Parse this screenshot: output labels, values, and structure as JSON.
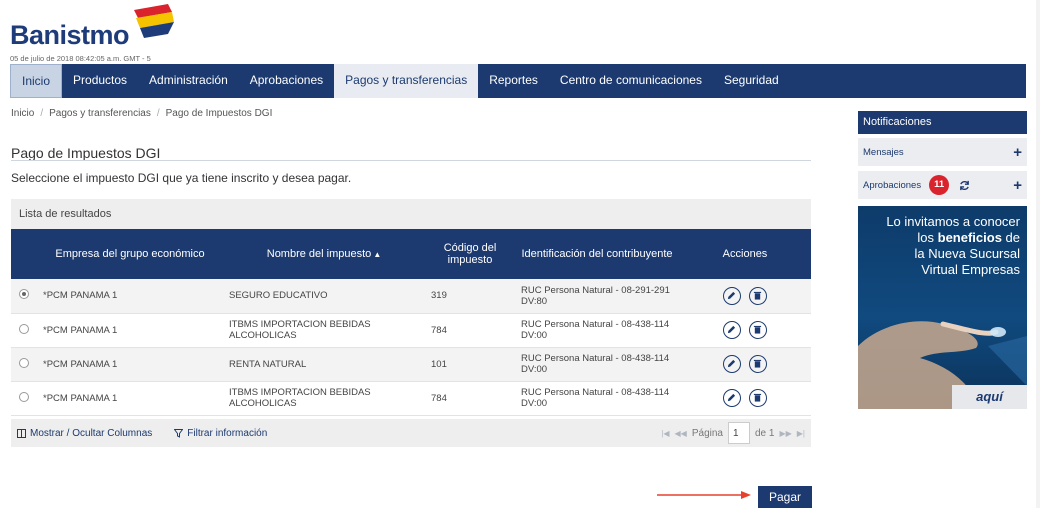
{
  "brand": {
    "name": "Banistmo"
  },
  "header": {
    "date": "05 de julio de 2018 08:42:05 a.m. GMT - 5"
  },
  "nav": {
    "items": [
      "Inicio",
      "Productos",
      "Administración",
      "Aprobaciones",
      "Pagos y transferencias",
      "Reportes",
      "Centro de comunicaciones",
      "Seguridad"
    ],
    "active": "Pagos y transferencias"
  },
  "breadcrumb": [
    "Inicio",
    "Pagos y transferencias",
    "Pago de Impuestos DGI"
  ],
  "page": {
    "title": "Pago de Impuestos DGI",
    "subtitle": "Seleccione el impuesto DGI que ya tiene inscrito y desea pagar."
  },
  "results": {
    "heading": "Lista de resultados",
    "columns": [
      "Empresa del grupo económico",
      "Nombre del impuesto",
      "Código del impuesto",
      "Identificación del contribuyente",
      "Acciones"
    ],
    "rows": [
      {
        "selected": true,
        "empresa": "*PCM PANAMA 1",
        "impuesto": "SEGURO EDUCATIVO",
        "codigo": "319",
        "identificacion": "RUC Persona Natural - 08-291-291 DV:80"
      },
      {
        "selected": false,
        "empresa": "*PCM PANAMA 1",
        "impuesto": "ITBMS IMPORTACION BEBIDAS ALCOHOLICAS",
        "codigo": "784",
        "identificacion": "RUC Persona Natural - 08-438-114 DV:00"
      },
      {
        "selected": false,
        "empresa": "*PCM PANAMA 1",
        "impuesto": "RENTA NATURAL",
        "codigo": "101",
        "identificacion": "RUC Persona Natural - 08-438-114 DV:00"
      },
      {
        "selected": false,
        "empresa": "*PCM PANAMA 1",
        "impuesto": "ITBMS IMPORTACION BEBIDAS ALCOHOLICAS",
        "codigo": "784",
        "identificacion": "RUC Persona Natural - 08-438-114 DV:00"
      }
    ],
    "footer": {
      "toggle_columns": "Mostrar / Ocultar Columnas",
      "filter": "Filtrar información",
      "page_label": "Página",
      "page_value": "1",
      "page_total": "de 1"
    }
  },
  "actions": {
    "pay": "Pagar"
  },
  "sidebar": {
    "title": "Notificaciones",
    "messages": "Mensajes",
    "approvals": "Aprobaciones",
    "approvals_count": "11",
    "promo": {
      "line1": "Lo invitamos a conocer",
      "line2_pre": "los ",
      "line2_bold": "beneficios",
      "line2_post": " de",
      "line3": "la Nueva Sucursal",
      "line4": "Virtual Empresas",
      "cta": "aquí"
    }
  },
  "colors": {
    "brand_navy": "#1c3a70",
    "badge_red": "#d9232d",
    "arrow_red": "#e8402e"
  },
  "icons": [
    "edit-pencil-icon",
    "trash-icon",
    "sort-asc-icon",
    "refresh-icon",
    "plus-icon",
    "columns-icon",
    "filter-icon"
  ]
}
